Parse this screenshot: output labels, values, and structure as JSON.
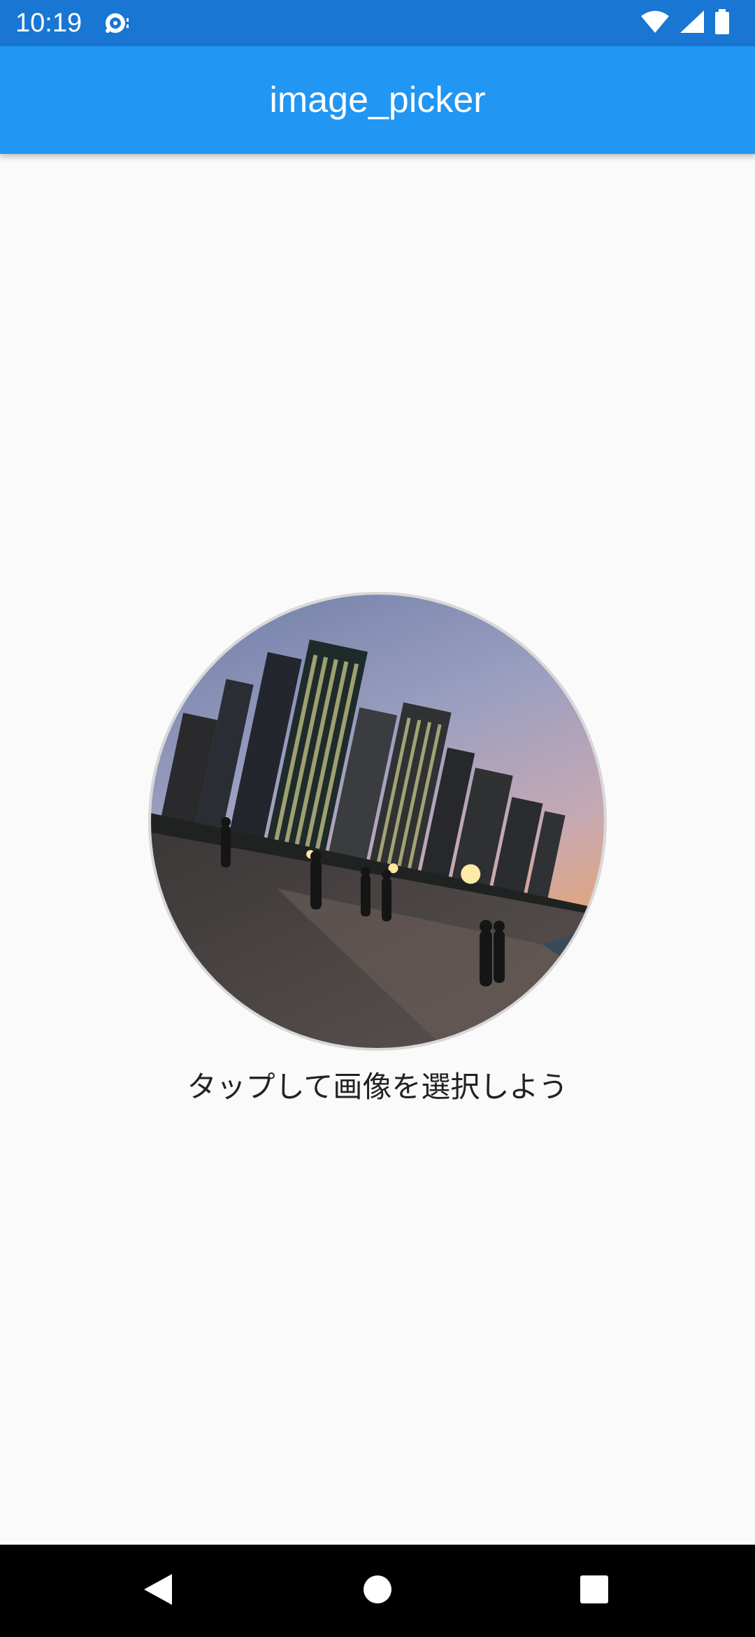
{
  "status_bar": {
    "time": "10:19",
    "icons": [
      "notification-icon",
      "wifi-icon",
      "signal-icon",
      "battery-icon"
    ],
    "color": "#1976d2"
  },
  "app_bar": {
    "title": "image_picker",
    "color": "#2196f3"
  },
  "main": {
    "image_description_icon": "city-skyline-photo",
    "caption": "タップして画像を選択しよう"
  },
  "nav_bar": {
    "buttons": [
      "back-icon",
      "home-icon",
      "recents-icon"
    ]
  }
}
